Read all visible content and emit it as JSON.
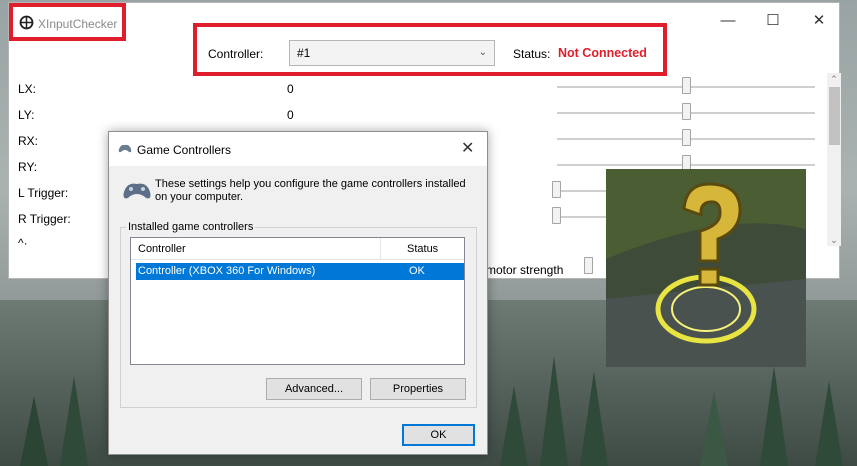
{
  "main_window": {
    "title": "XInputChecker",
    "controller_label": "Controller:",
    "controller_value": "#1",
    "status_label": "Status:",
    "status_value": "Not Connected",
    "status_color": "#e01e2b",
    "highlight_color": "#e01e2b",
    "rows": [
      {
        "label": "LX:",
        "value": "0"
      },
      {
        "label": "LY:",
        "value": "0"
      },
      {
        "label": "RX:",
        "value": ""
      },
      {
        "label": "RY:",
        "value": ""
      },
      {
        "label": "L Trigger:",
        "value": ""
      },
      {
        "label": "R Trigger:",
        "value": ""
      },
      {
        "label": "^·",
        "value": ""
      }
    ],
    "motor_label": "motor strength"
  },
  "dialog": {
    "title": "Game Controllers",
    "description": "These settings help you configure the game controllers installed on your computer.",
    "group_title": "Installed game controllers",
    "columns": [
      "Controller",
      "Status"
    ],
    "rows": [
      {
        "controller": "Controller (XBOX 360 For Windows)",
        "status": "OK"
      }
    ],
    "advanced_label": "Advanced...",
    "properties_label": "Properties",
    "ok_label": "OK",
    "selection_color": "#0078d7"
  },
  "icons": {
    "app": "crosshair-icon",
    "minimize": "minimize-icon",
    "maximize": "maximize-icon",
    "close": "close-icon",
    "gamepad": "gamepad-icon",
    "question_image": "question-mark-image"
  }
}
